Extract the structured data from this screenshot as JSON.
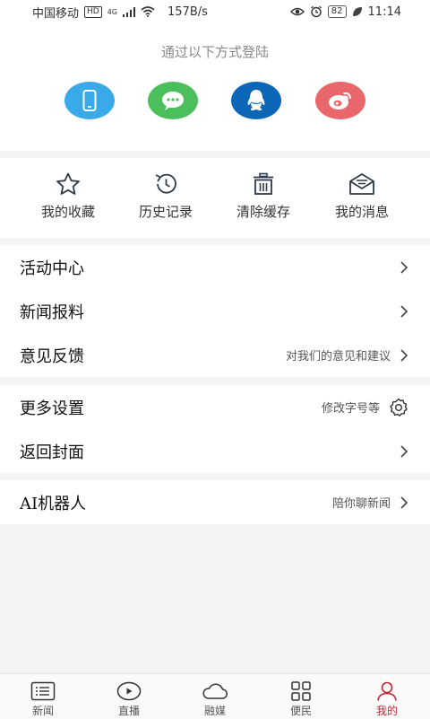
{
  "status_bar": {
    "carrier": "中国移动",
    "hd_badge": "HD",
    "network_type": "4G",
    "speed": "157B/s",
    "battery": "82",
    "time": "11:14"
  },
  "login": {
    "title": "通过以下方式登陆",
    "methods": [
      {
        "icon": "phone-icon",
        "color": "#3aa9e8"
      },
      {
        "icon": "wechat-icon",
        "color": "#4bbf5c"
      },
      {
        "icon": "qq-icon",
        "color": "#0b66b7"
      },
      {
        "icon": "weibo-icon",
        "color": "#e9666a"
      }
    ]
  },
  "quick_actions": [
    {
      "label": "我的收藏",
      "icon": "star-icon"
    },
    {
      "label": "历史记录",
      "icon": "history-icon"
    },
    {
      "label": "清除缓存",
      "icon": "trash-icon"
    },
    {
      "label": "我的消息",
      "icon": "mail-icon"
    }
  ],
  "menu": {
    "activity_center": "活动中心",
    "news_report": "新闻报料",
    "feedback": "意见反馈",
    "feedback_hint": "对我们的意见和建议",
    "more_settings": "更多设置",
    "more_settings_hint": "修改字号等",
    "back_to_cover": "返回封面",
    "ai_robot": "AI机器人",
    "ai_robot_hint": "陪你聊新闻"
  },
  "tabbar": [
    {
      "label": "新闻",
      "icon": "news-list-icon"
    },
    {
      "label": "直播",
      "icon": "live-play-icon"
    },
    {
      "label": "融媒",
      "icon": "cloud-icon"
    },
    {
      "label": "便民",
      "icon": "grid-icon"
    },
    {
      "label": "我的",
      "icon": "user-icon",
      "active": true
    }
  ],
  "colors": {
    "accent_red": "#c0262d",
    "icon_dark": "#2f3b48"
  }
}
